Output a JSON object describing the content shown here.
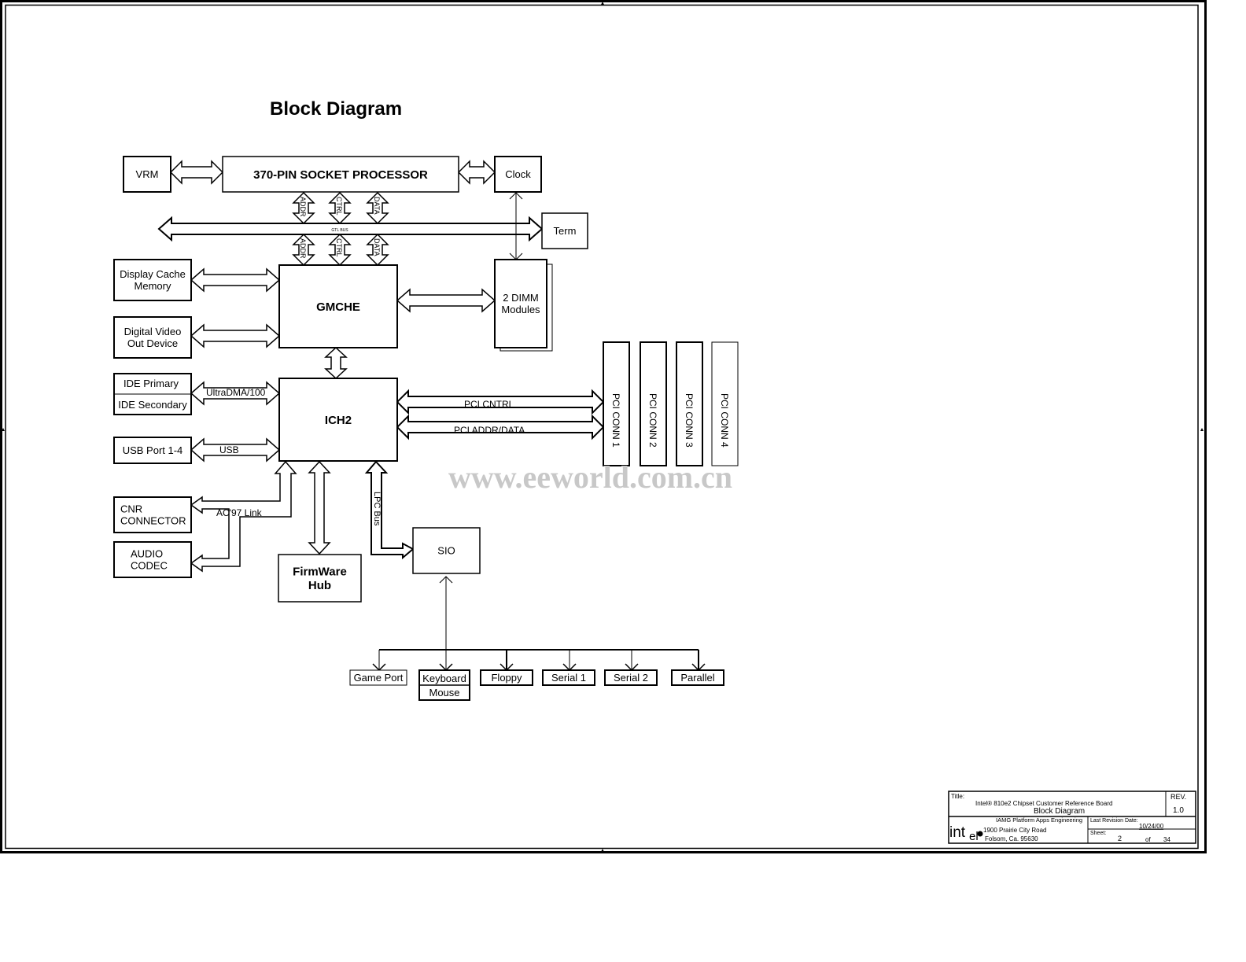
{
  "diagram": {
    "title": "Block Diagram",
    "watermark": "www.eeworld.com.cn",
    "blocks": {
      "vrm": "VRM",
      "cpu": "370-PIN SOCKET PROCESSOR",
      "clock": "Clock",
      "term": "Term",
      "display_cache": [
        "Display Cache",
        "Memory"
      ],
      "dvo": [
        "Digital Video",
        "Out Device"
      ],
      "gmche": "GMCHE",
      "dimm": [
        "2 DIMM",
        "Modules"
      ],
      "ide_primary": "IDE Primary",
      "ide_secondary": "IDE Secondary",
      "usb_port": "USB Port 1-4",
      "ich2": "ICH2",
      "pci_conn": [
        "PCI CONN 1",
        "PCI CONN 2",
        "PCI CONN 3",
        "PCI CONN 4"
      ],
      "cnr": [
        "CNR",
        "CONNECTOR"
      ],
      "audio": [
        "AUDIO",
        "CODEC"
      ],
      "fwh": [
        "FirmWare",
        "Hub"
      ],
      "sio": "SIO",
      "game_port": "Game Port",
      "keyboard": "Keyboard",
      "mouse": "Mouse",
      "floppy": "Floppy",
      "serial1": "Serial 1",
      "serial2": "Serial 2",
      "parallel": "Parallel"
    },
    "bus_labels": {
      "gtl": "GTL BUS",
      "addr": "ADDR",
      "ctrl": "CTRL",
      "data": "DATA",
      "ultradma": "UltraDMA/100",
      "usb": "USB",
      "pci_cntrl": "PCI CNTRL",
      "pci_addr_data": "PCI ADDR/DATA",
      "ac97": "AC'97 Link",
      "lpc": "LPC Bus"
    }
  },
  "title_block": {
    "title_label": "Title:",
    "title_line1": "Intel® 810e2 Chipset Customer Reference Board",
    "title_line2": "Block Diagram",
    "rev_label": "REV.",
    "rev_value": "1.0",
    "company_logo": "intel",
    "address": [
      "IAMG Platform Apps Engineering",
      "1900 Prairie City Road",
      "Folsom, Ca. 95630"
    ],
    "last_rev_label": "Last Revision Date:",
    "last_rev_value": "10/24/00",
    "sheet_label": "Sheet:",
    "sheet_value": "2",
    "sheet_of": "of",
    "sheet_total": "34"
  }
}
